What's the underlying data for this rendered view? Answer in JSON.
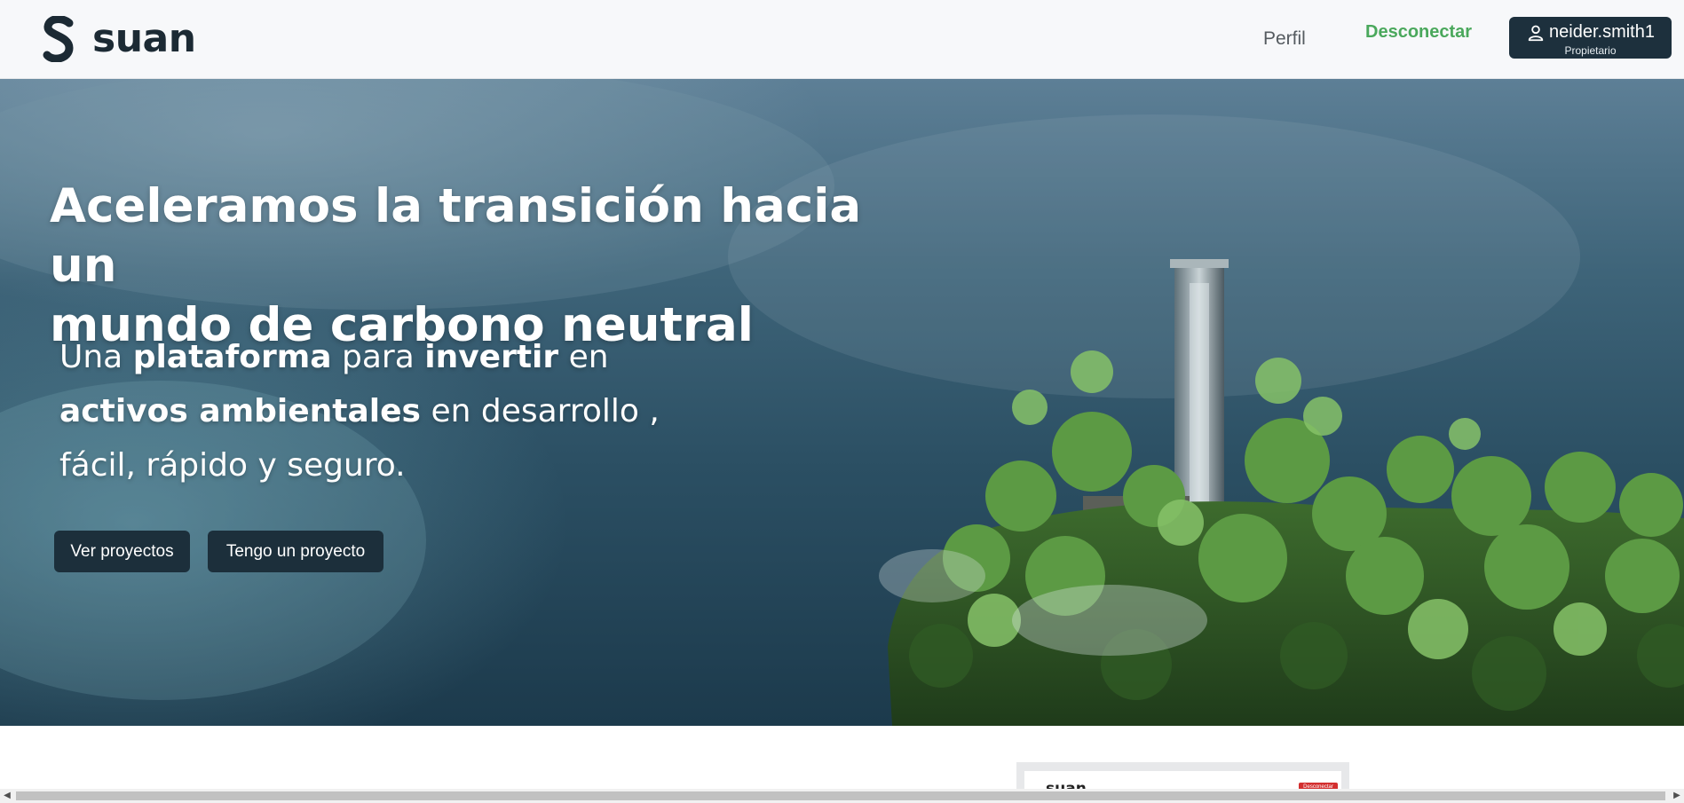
{
  "header": {
    "logo_text": "suan",
    "nav_profile": "Perfil",
    "nav_disconnect": "Desconectar",
    "user_name": "neider.smith1",
    "user_role": "Propietario"
  },
  "hero": {
    "title_line1": "Aceleramos la transición hacia un",
    "title_line2_plain": "mundo de",
    "title_line2_bold": "carbono neutral",
    "sub_1": "Una",
    "sub_2": "plataforma",
    "sub_3": "para",
    "sub_4": "invertir",
    "sub_5": "en",
    "sub_6": "activos ambientales",
    "sub_7": "en desarrollo ,",
    "sub_8": "fácil, rápido y seguro.",
    "btn_projects": "Ver proyectos",
    "btn_have_project": "Tengo un proyecto"
  },
  "preview": {
    "logo_text": "suan",
    "button_label": "Desconectar"
  },
  "icons": {
    "logo": "suan-logo-icon",
    "user": "user-icon",
    "scroll_left": "chevron-left-icon",
    "scroll_right": "chevron-right-icon"
  },
  "colors": {
    "nav_bg": "#f7f8fa",
    "accent_green": "#4aa85c",
    "button_dark": "#1c2f3b",
    "brand_text": "#1c2a34"
  }
}
